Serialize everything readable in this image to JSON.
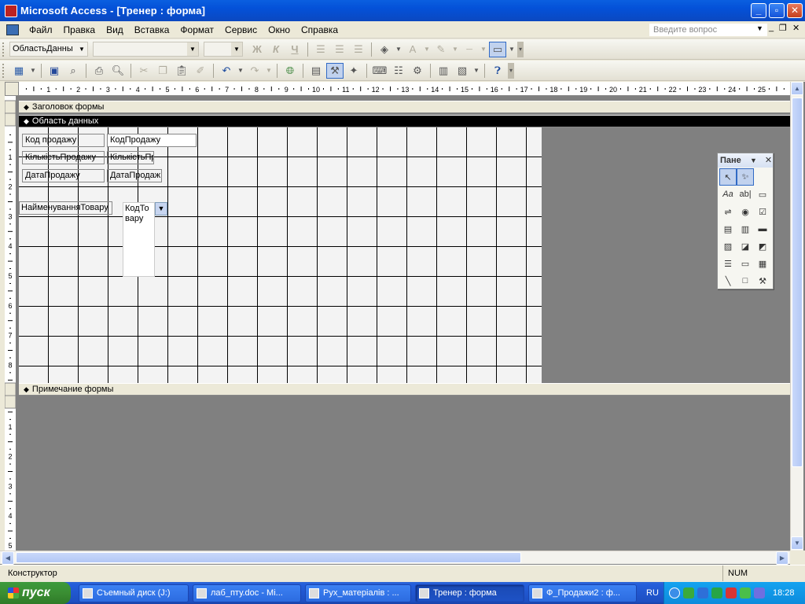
{
  "window": {
    "title": "Microsoft Access - [Тренер : форма]"
  },
  "menu": {
    "items": [
      "Файл",
      "Правка",
      "Вид",
      "Вставка",
      "Формат",
      "Сервис",
      "Окно",
      "Справка"
    ],
    "ask_placeholder": "Введите вопрос"
  },
  "toolbar1": {
    "object_combo": "ОбластьДанны",
    "font_combo": "",
    "size_combo": ""
  },
  "ruler": {
    "top_numbers": [
      "1",
      "2",
      "3",
      "4",
      "5",
      "6",
      "7",
      "8",
      "9",
      "10",
      "11",
      "12",
      "13",
      "14",
      "15",
      "16",
      "17",
      "18",
      "19",
      "20",
      "21",
      "22",
      "23",
      "24",
      "25"
    ],
    "left_numbers_detail": [
      "1",
      "2",
      "3",
      "4",
      "5",
      "6",
      "7",
      "8"
    ],
    "left_numbers_footer": [
      "1",
      "2",
      "3",
      "4",
      "5"
    ]
  },
  "sections": {
    "header": "Заголовок формы",
    "detail": "Область данных",
    "footer": "Примечание формы"
  },
  "controls": {
    "label_kod_prodazhu": "Код продажу",
    "text_kod_prodazhu": "КодПродажу",
    "label_kilkist": "КількістьПродажу",
    "text_kilkist": "КількістьПр",
    "label_data": "ДатаПродажу",
    "text_data": "ДатаПродаж",
    "label_naimenuvannia": "НайменуванняТовару",
    "listbox_kod_tovaru": "КодТовару"
  },
  "toolbox": {
    "title": "Пане"
  },
  "status": {
    "mode": "Конструктор",
    "num": "NUM"
  },
  "taskbar": {
    "start": "пуск",
    "tasks": [
      "Съемный диск (J:)",
      "лаб_пту.doc - Mi...",
      "Рух_матеріалів : ...",
      "Тренер : форма",
      "Ф_Продажи2 : ф..."
    ],
    "lang": "RU",
    "time": "18:28"
  }
}
